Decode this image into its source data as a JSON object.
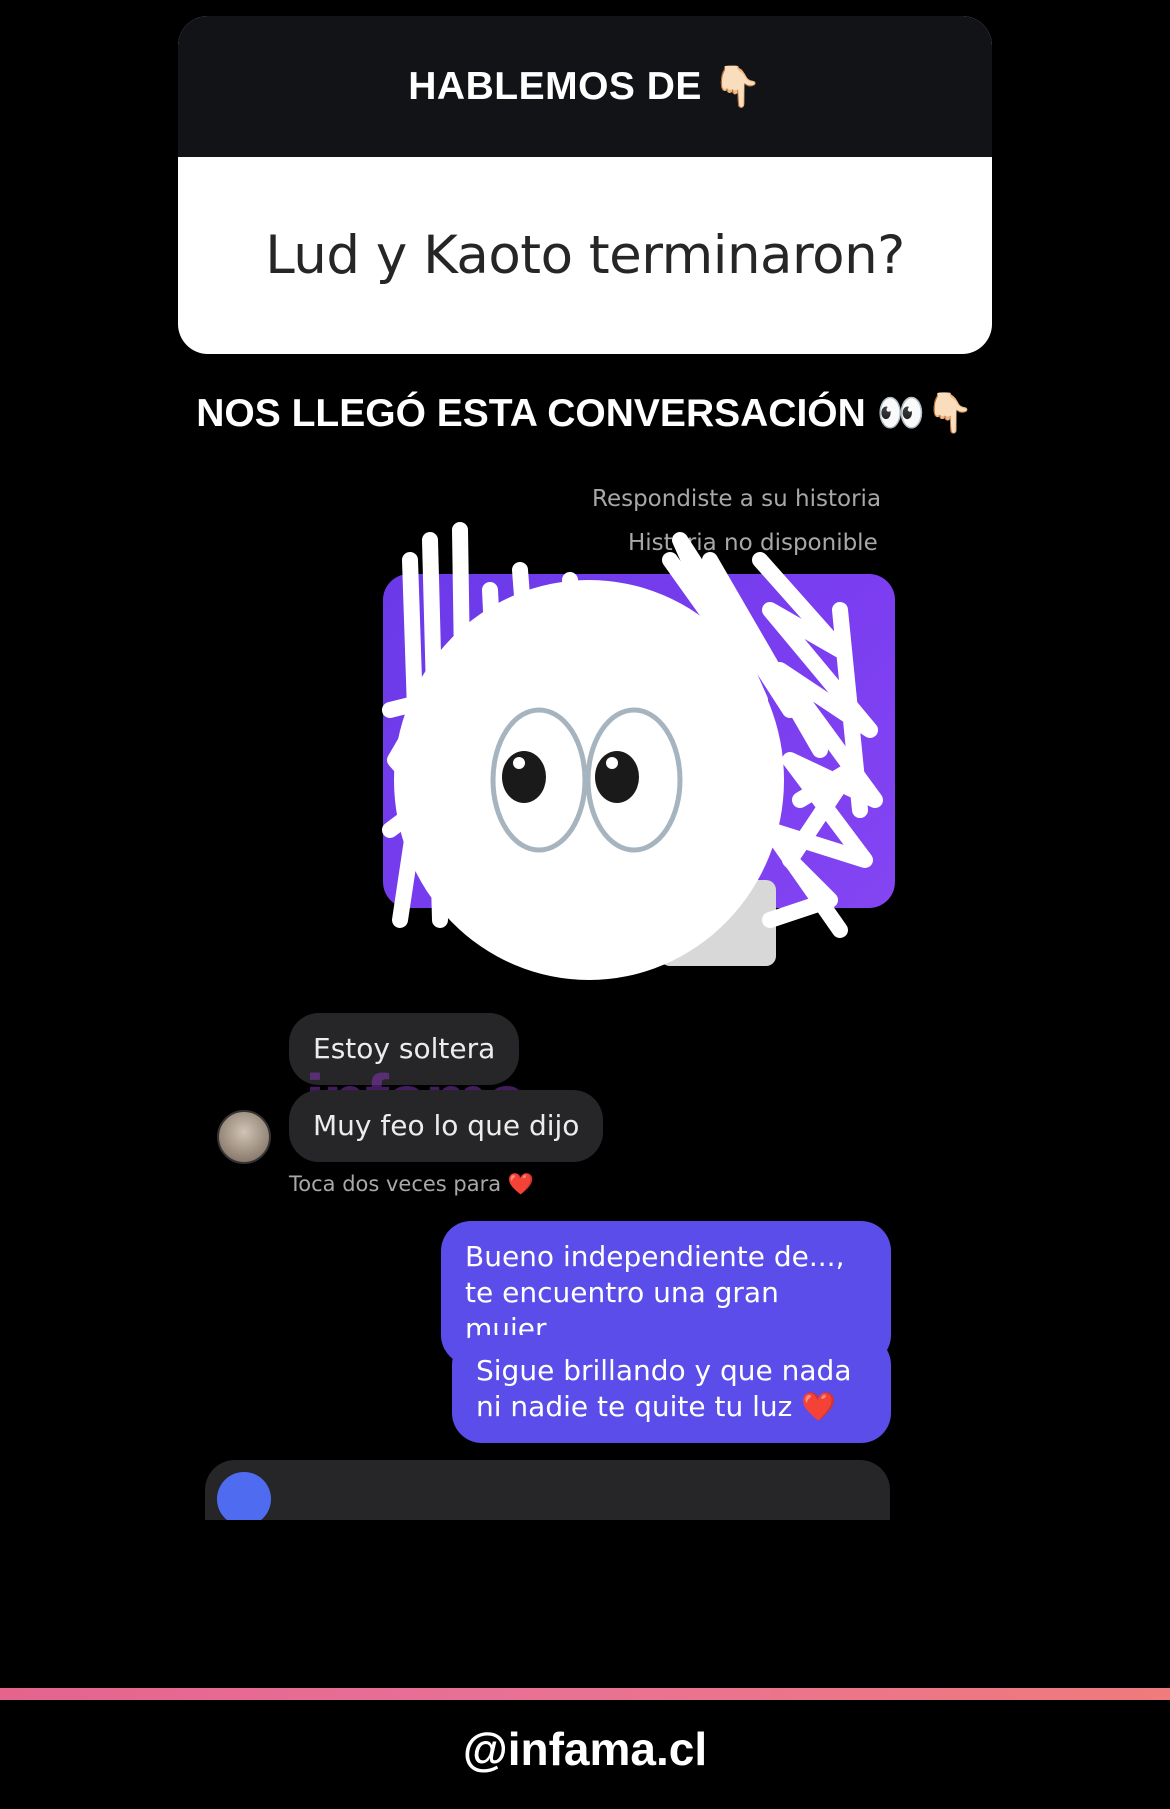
{
  "question_sticker": {
    "header": "HABLEMOS DE",
    "header_emoji": "👇🏻",
    "question": "Lud y Kaoto terminaron?"
  },
  "subheading": "NOS LLEGÓ ESTA CONVERSACIÓN 👀👇🏻",
  "chat": {
    "story_reply_label": "Respondiste a su historia",
    "story_unavailable": "Historia no disponible",
    "watermark": "infama",
    "messages_in": [
      "Estoy soltera",
      "Muy feo lo que dijo"
    ],
    "tap_hint": "Toca dos veces para ❤️",
    "messages_out": [
      "Bueno independiente de..., te encuentro una gran mujer",
      "Sigue brillando y que nada ni nadie te quite tu luz ❤️"
    ]
  },
  "sticker": {
    "emoji": "👀"
  },
  "footer": {
    "handle": "@infama.cl"
  },
  "colors": {
    "question_header_bg": "#121316",
    "story_purple": "#7b3ef0",
    "outgoing_bubble": "#5a4de9",
    "incoming_bubble": "#262628",
    "footer_line": "#e77097"
  }
}
